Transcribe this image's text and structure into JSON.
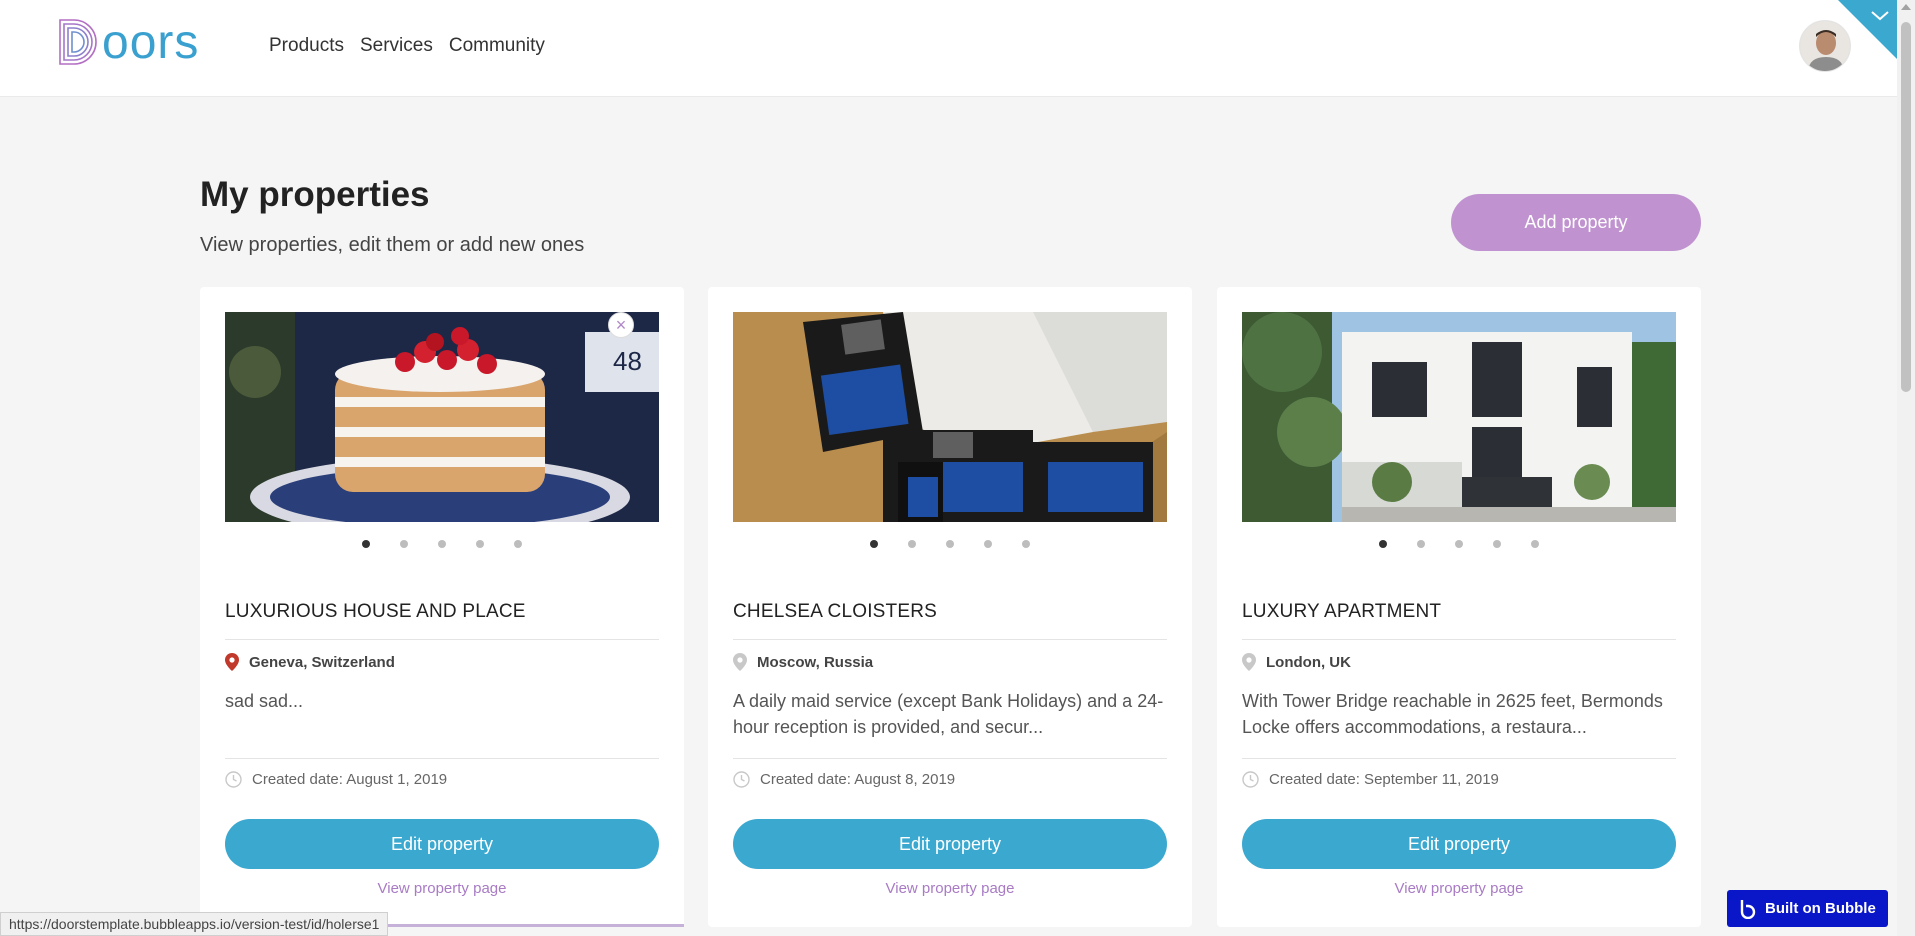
{
  "header": {
    "logo_text": "Doors",
    "nav": [
      "Products",
      "Services",
      "Community"
    ]
  },
  "page": {
    "title": "My properties",
    "subtitle": "View properties, edit them or add new ones",
    "add_button": "Add property"
  },
  "cards": [
    {
      "title": "LUXURIOUS HOUSE AND PLACE",
      "location": "Geneva, Switzerland",
      "location_pin_color": "#c0392b",
      "description": "sad sad...",
      "created": "Created date: August 1, 2019",
      "edit_label": "Edit property",
      "view_label": "View property page",
      "image": "cake with strawberries"
    },
    {
      "title": "CHELSEA CLOISTERS",
      "location": "Moscow, Russia",
      "location_pin_color": "#c8c8c8",
      "description": "A daily maid service (except Bank Holidays) and a 24-hour reception is provided, and secur...",
      "created": "Created date: August 8, 2019",
      "edit_label": "Edit property",
      "view_label": "View property page",
      "image": "Windows 8.1 floppy disks"
    },
    {
      "title": "LUXURY APARTMENT",
      "location": "London, UK",
      "location_pin_color": "#c8c8c8",
      "description": "With Tower Bridge reachable in 2625 feet, Bermonds Locke offers accommodations, a restaura...",
      "created": "Created date: September 11, 2019",
      "edit_label": "Edit property",
      "view_label": "View property page",
      "image": "modern white house"
    }
  ],
  "status_bar": {
    "url": "https://doorstemplate.bubbleapps.io/version-test/id/holerse1"
  },
  "badge": {
    "label": "Built on Bubble"
  },
  "colors": {
    "accent_purple": "#c093d0",
    "accent_blue": "#3ba8cf",
    "link_purple": "#a87bc4",
    "bubble_blue": "#0a17c8"
  }
}
